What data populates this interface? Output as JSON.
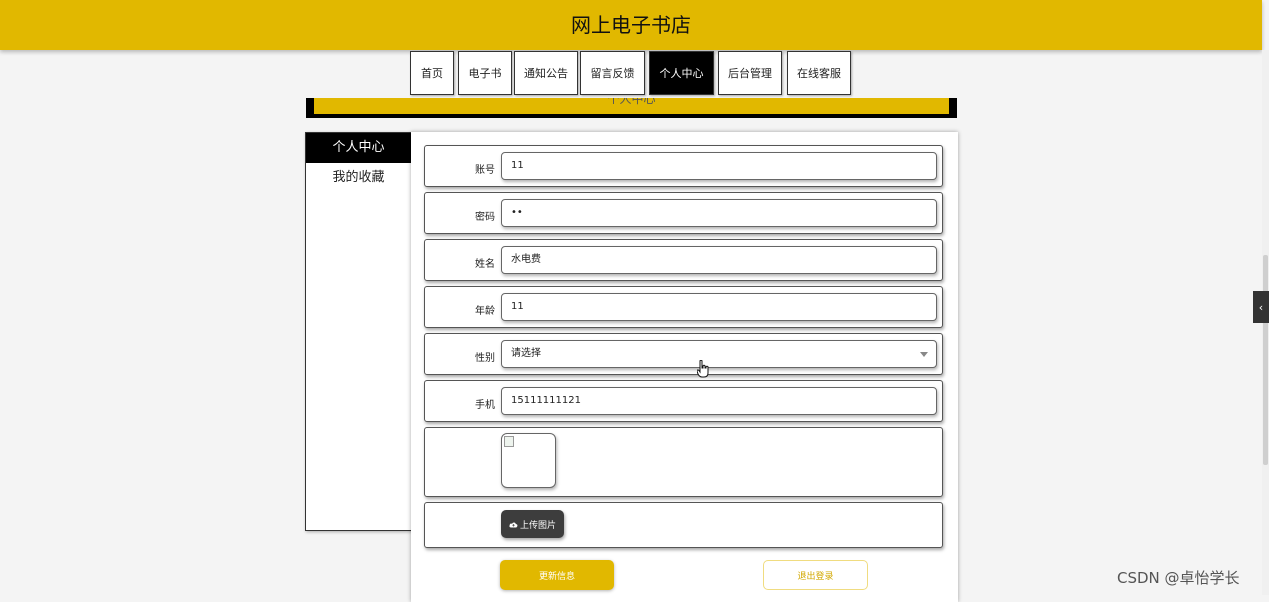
{
  "header": {
    "title": "网上电子书店"
  },
  "nav": {
    "items": [
      {
        "label": "首页"
      },
      {
        "label": "电子书"
      },
      {
        "label": "通知公告"
      },
      {
        "label": "留言反馈"
      },
      {
        "label": "个人中心"
      },
      {
        "label": "后台管理"
      },
      {
        "label": "在线客服"
      }
    ],
    "active": "个人中心"
  },
  "banner": {
    "title": "个人中心"
  },
  "sidebar": {
    "items": [
      {
        "label": "个人中心"
      },
      {
        "label": "我的收藏"
      }
    ],
    "active": "个人中心"
  },
  "form": {
    "account": {
      "label": "账号",
      "value": "11"
    },
    "password": {
      "label": "密码",
      "value": "••"
    },
    "name": {
      "label": "姓名",
      "value": "水电费"
    },
    "age": {
      "label": "年龄",
      "value": "11"
    },
    "gender": {
      "label": "性别",
      "value": "请选择"
    },
    "phone": {
      "label": "手机",
      "value": "15111111121"
    },
    "upload_label": "上传图片"
  },
  "actions": {
    "update": "更新信息",
    "logout": "退出登录"
  },
  "side_tab_icon": "chevron-left-icon",
  "watermark": "CSDN @卓怡学长",
  "colors": {
    "accent": "#e1b800",
    "dark": "#000000",
    "button_dark": "#3d3d3d"
  }
}
